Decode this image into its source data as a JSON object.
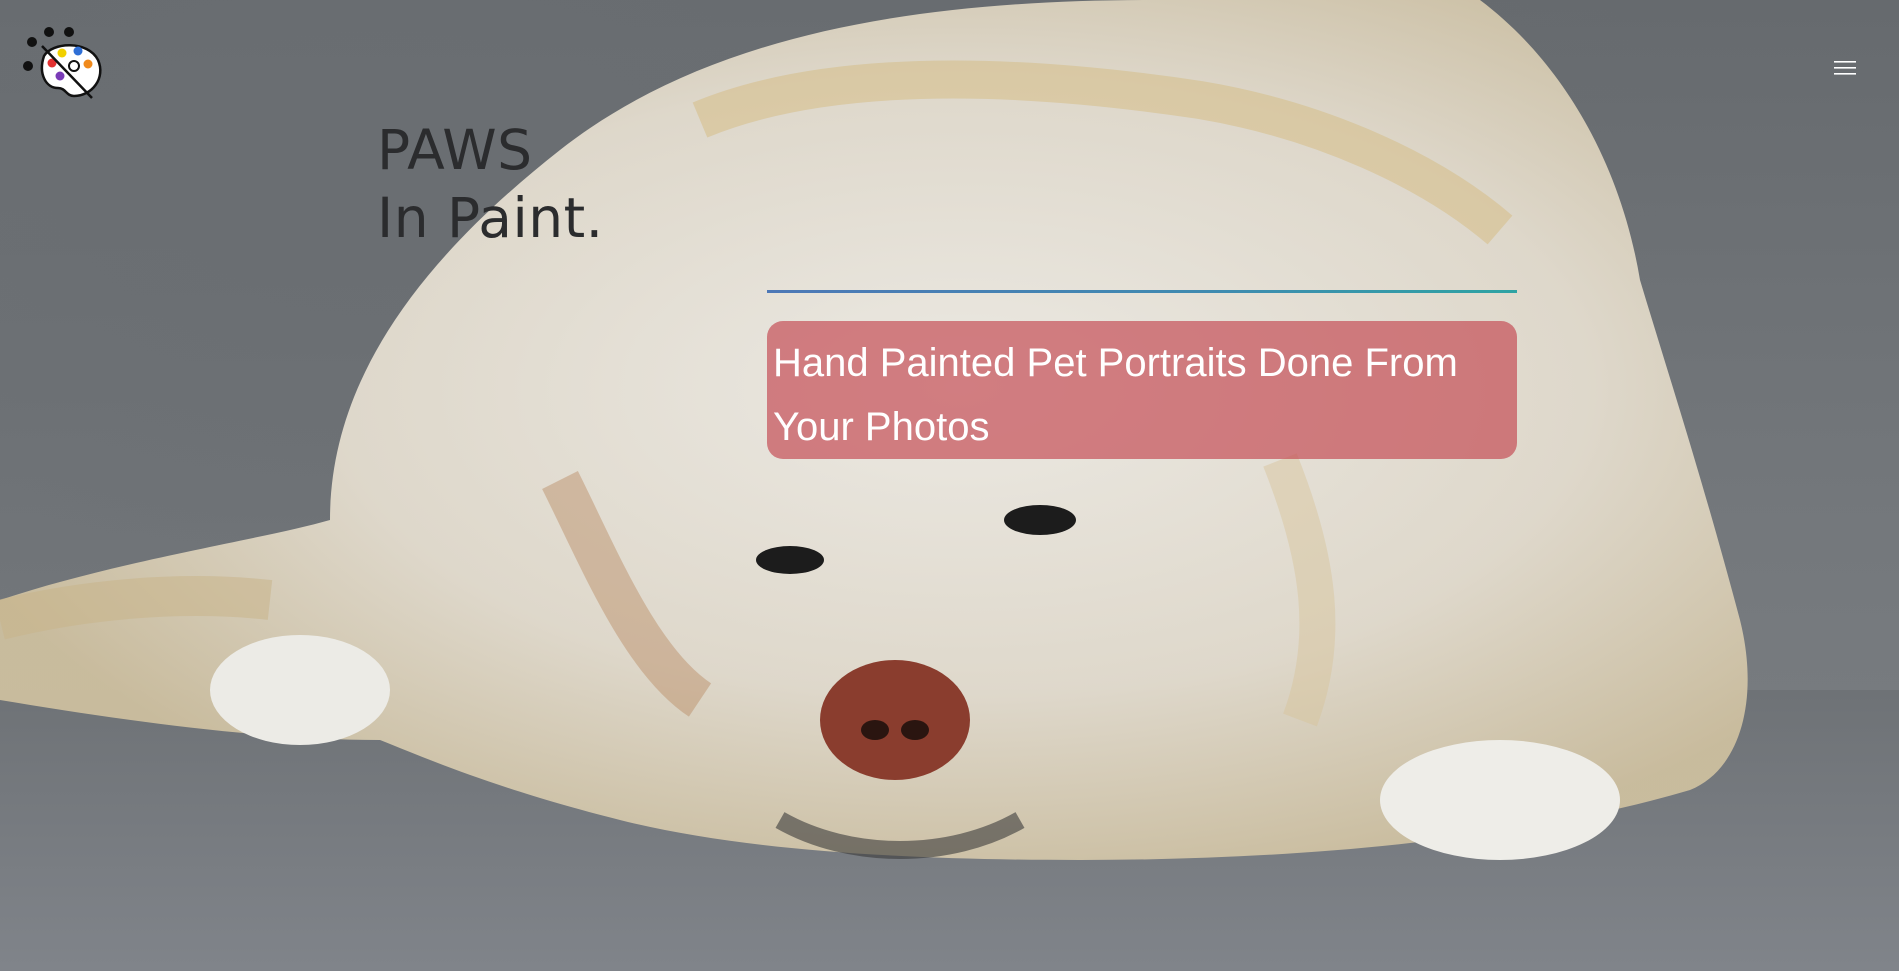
{
  "site": {
    "title_line1": "PAWS",
    "title_line2": "In Paint."
  },
  "header": {
    "logo_icon": "paw-palette-logo-icon",
    "menu_icon": "hamburger-menu-icon"
  },
  "hero": {
    "tagline": "Hand Painted Pet Portraits Done From Your Photos",
    "background_image": "painted-labrador-dog-portrait",
    "accent_line_colors": [
      "#4d78b6",
      "#2ea3a3"
    ],
    "tagline_box_color": "#c44a52"
  }
}
